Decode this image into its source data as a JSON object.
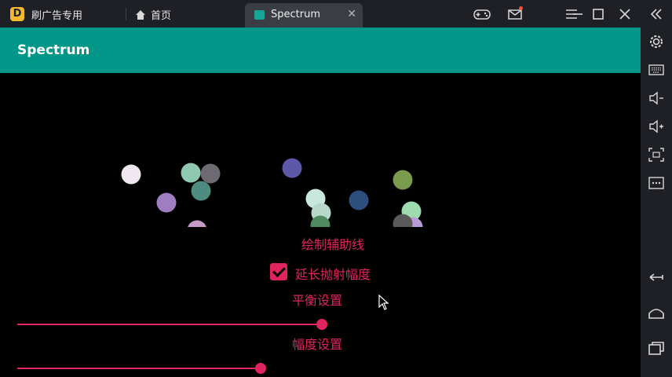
{
  "emulator": {
    "app_name": "刷广告专用",
    "home_tab_label": "首页",
    "active_tab_label": "Spectrum",
    "close_tab_glyph": "✕",
    "controls": [
      "gamepad-icon",
      "mail-icon",
      "menu-icon",
      "minimize-icon",
      "maximize-icon",
      "close-icon",
      "collapse-icon"
    ],
    "sidebar_icons": [
      "settings-icon",
      "keyboard-icon",
      "volume-down-icon",
      "volume-up-icon",
      "screenshot-icon",
      "more-icon",
      "back-icon",
      "home-icon",
      "recents-icon"
    ]
  },
  "app": {
    "title": "Spectrum",
    "accent_color": "#e0245e",
    "appbar_color": "#009688",
    "draw_helper_lines_label": "绘制辅助线",
    "extend_throw_label": "延长抛射幅度",
    "extend_throw_checked": true,
    "balance_label": "平衡设置",
    "balance_value": 0.5,
    "amplitude_label": "幅度设置",
    "amplitude_value": 0.4
  },
  "spectrum_dots": [
    {
      "color": "#f0e6f0"
    },
    {
      "color": "#a07cc0"
    },
    {
      "color": "#8fc8b0"
    },
    {
      "color": "#6e6a72"
    },
    {
      "color": "#4e8c80"
    },
    {
      "color": "#c79ac8"
    },
    {
      "color": "#5e58a8"
    },
    {
      "color": "#c8e8dc"
    },
    {
      "color": "#b8d8cc"
    },
    {
      "color": "#2e4e7e"
    },
    {
      "color": "#7a9a4e"
    },
    {
      "color": "#9edcb0"
    },
    {
      "color": "#b89ad8"
    },
    {
      "color": "#5a5a5a"
    },
    {
      "color": "#4e8c60"
    }
  ]
}
